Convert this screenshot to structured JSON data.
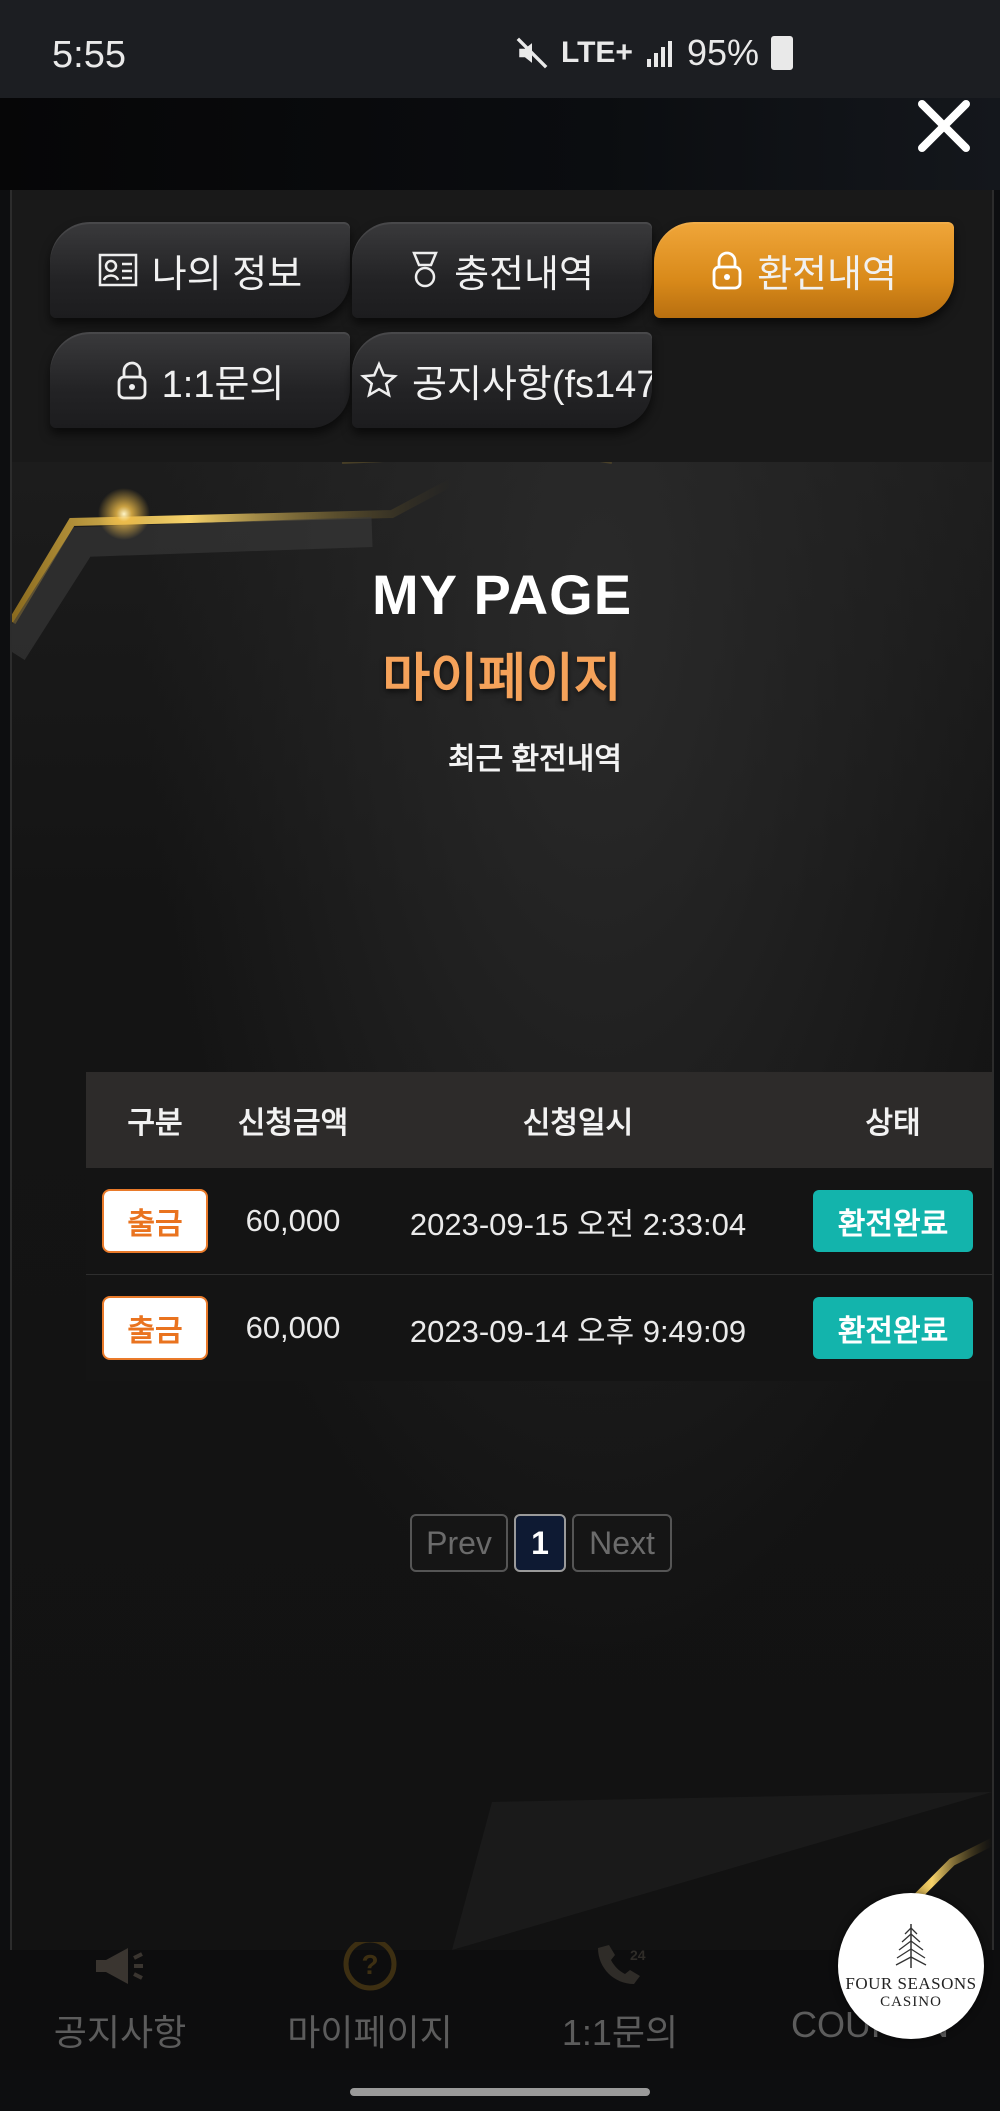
{
  "status": {
    "time": "5:55",
    "network": "LTE+",
    "battery": "95%"
  },
  "tabs": [
    {
      "label": "나의 정보",
      "icon": "id-card-icon",
      "active": false
    },
    {
      "label": "충전내역",
      "icon": "medal-icon",
      "active": false
    },
    {
      "label": "환전내역",
      "icon": "lock-icon",
      "active": true
    },
    {
      "label": "1:1문의",
      "icon": "lock-icon",
      "active": false
    },
    {
      "label": "공지사항(fs147",
      "icon": "star-icon",
      "active": false
    }
  ],
  "page": {
    "title": "MY PAGE",
    "subtitle": "마이페이지",
    "section_title": "최근 환전내역"
  },
  "table": {
    "headers": [
      "구분",
      "신청금액",
      "신청일시",
      "상태"
    ],
    "rows": [
      {
        "type": "출금",
        "amount": "60,000",
        "datetime": "2023-09-15 오전 2:33:04",
        "status": "환전완료"
      },
      {
        "type": "출금",
        "amount": "60,000",
        "datetime": "2023-09-14 오후 9:49:09",
        "status": "환전완료"
      }
    ]
  },
  "pagination": {
    "prev": "Prev",
    "current": "1",
    "next": "Next"
  },
  "bottom_nav": [
    {
      "label": "공지사항",
      "icon": "megaphone-icon"
    },
    {
      "label": "마이페이지",
      "icon": "question-icon"
    },
    {
      "label": "1:1문의",
      "icon": "phone-24-icon"
    },
    {
      "label": "COUPON",
      "icon": "coupon-icon"
    }
  ],
  "logo": {
    "line1": "FOUR SEASONS",
    "line2": "CASINO"
  },
  "colors": {
    "accent_orange": "#e08f1f",
    "status_teal": "#13b4ac",
    "subtitle_orange": "#f5a25a"
  }
}
